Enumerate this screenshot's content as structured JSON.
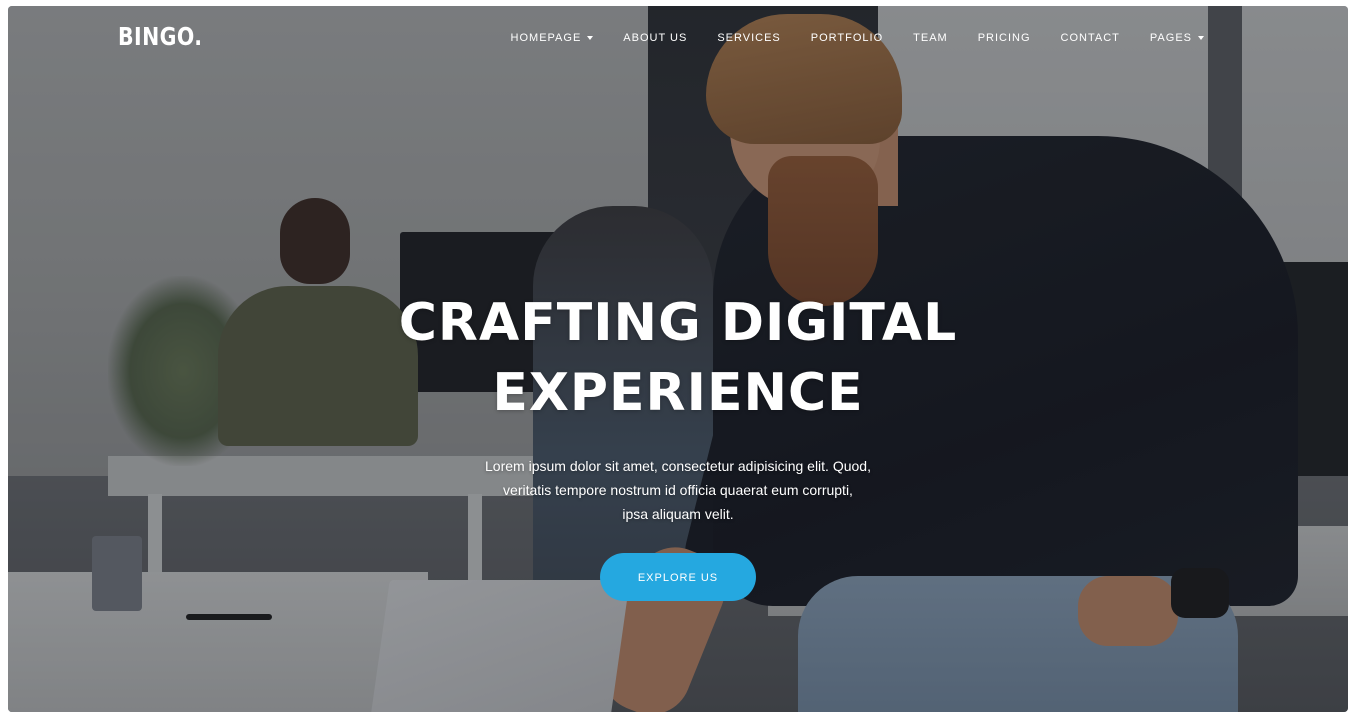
{
  "brand": {
    "logo": "BINGO."
  },
  "nav": {
    "items": [
      {
        "label": "HOMEPAGE",
        "has_dropdown": true
      },
      {
        "label": "ABOUT US",
        "has_dropdown": false
      },
      {
        "label": "SERVICES",
        "has_dropdown": false
      },
      {
        "label": "PORTFOLIO",
        "has_dropdown": false
      },
      {
        "label": "TEAM",
        "has_dropdown": false
      },
      {
        "label": "PRICING",
        "has_dropdown": false
      },
      {
        "label": "CONTACT",
        "has_dropdown": false
      },
      {
        "label": "PAGES",
        "has_dropdown": true
      }
    ]
  },
  "hero": {
    "title_line1": "CRAFTING DIGITAL",
    "title_line2": "EXPERIENCE",
    "desc_line1": "Lorem ipsum dolor sit amet, consectetur adipisicing elit. Quod,",
    "desc_line2": "veritatis tempore nostrum id officia quaerat eum corrupti,",
    "desc_line3": "ipsa aliquam velit.",
    "cta_label": "EXPLORE US"
  },
  "colors": {
    "accent": "#25a8e0",
    "text": "#ffffff"
  }
}
